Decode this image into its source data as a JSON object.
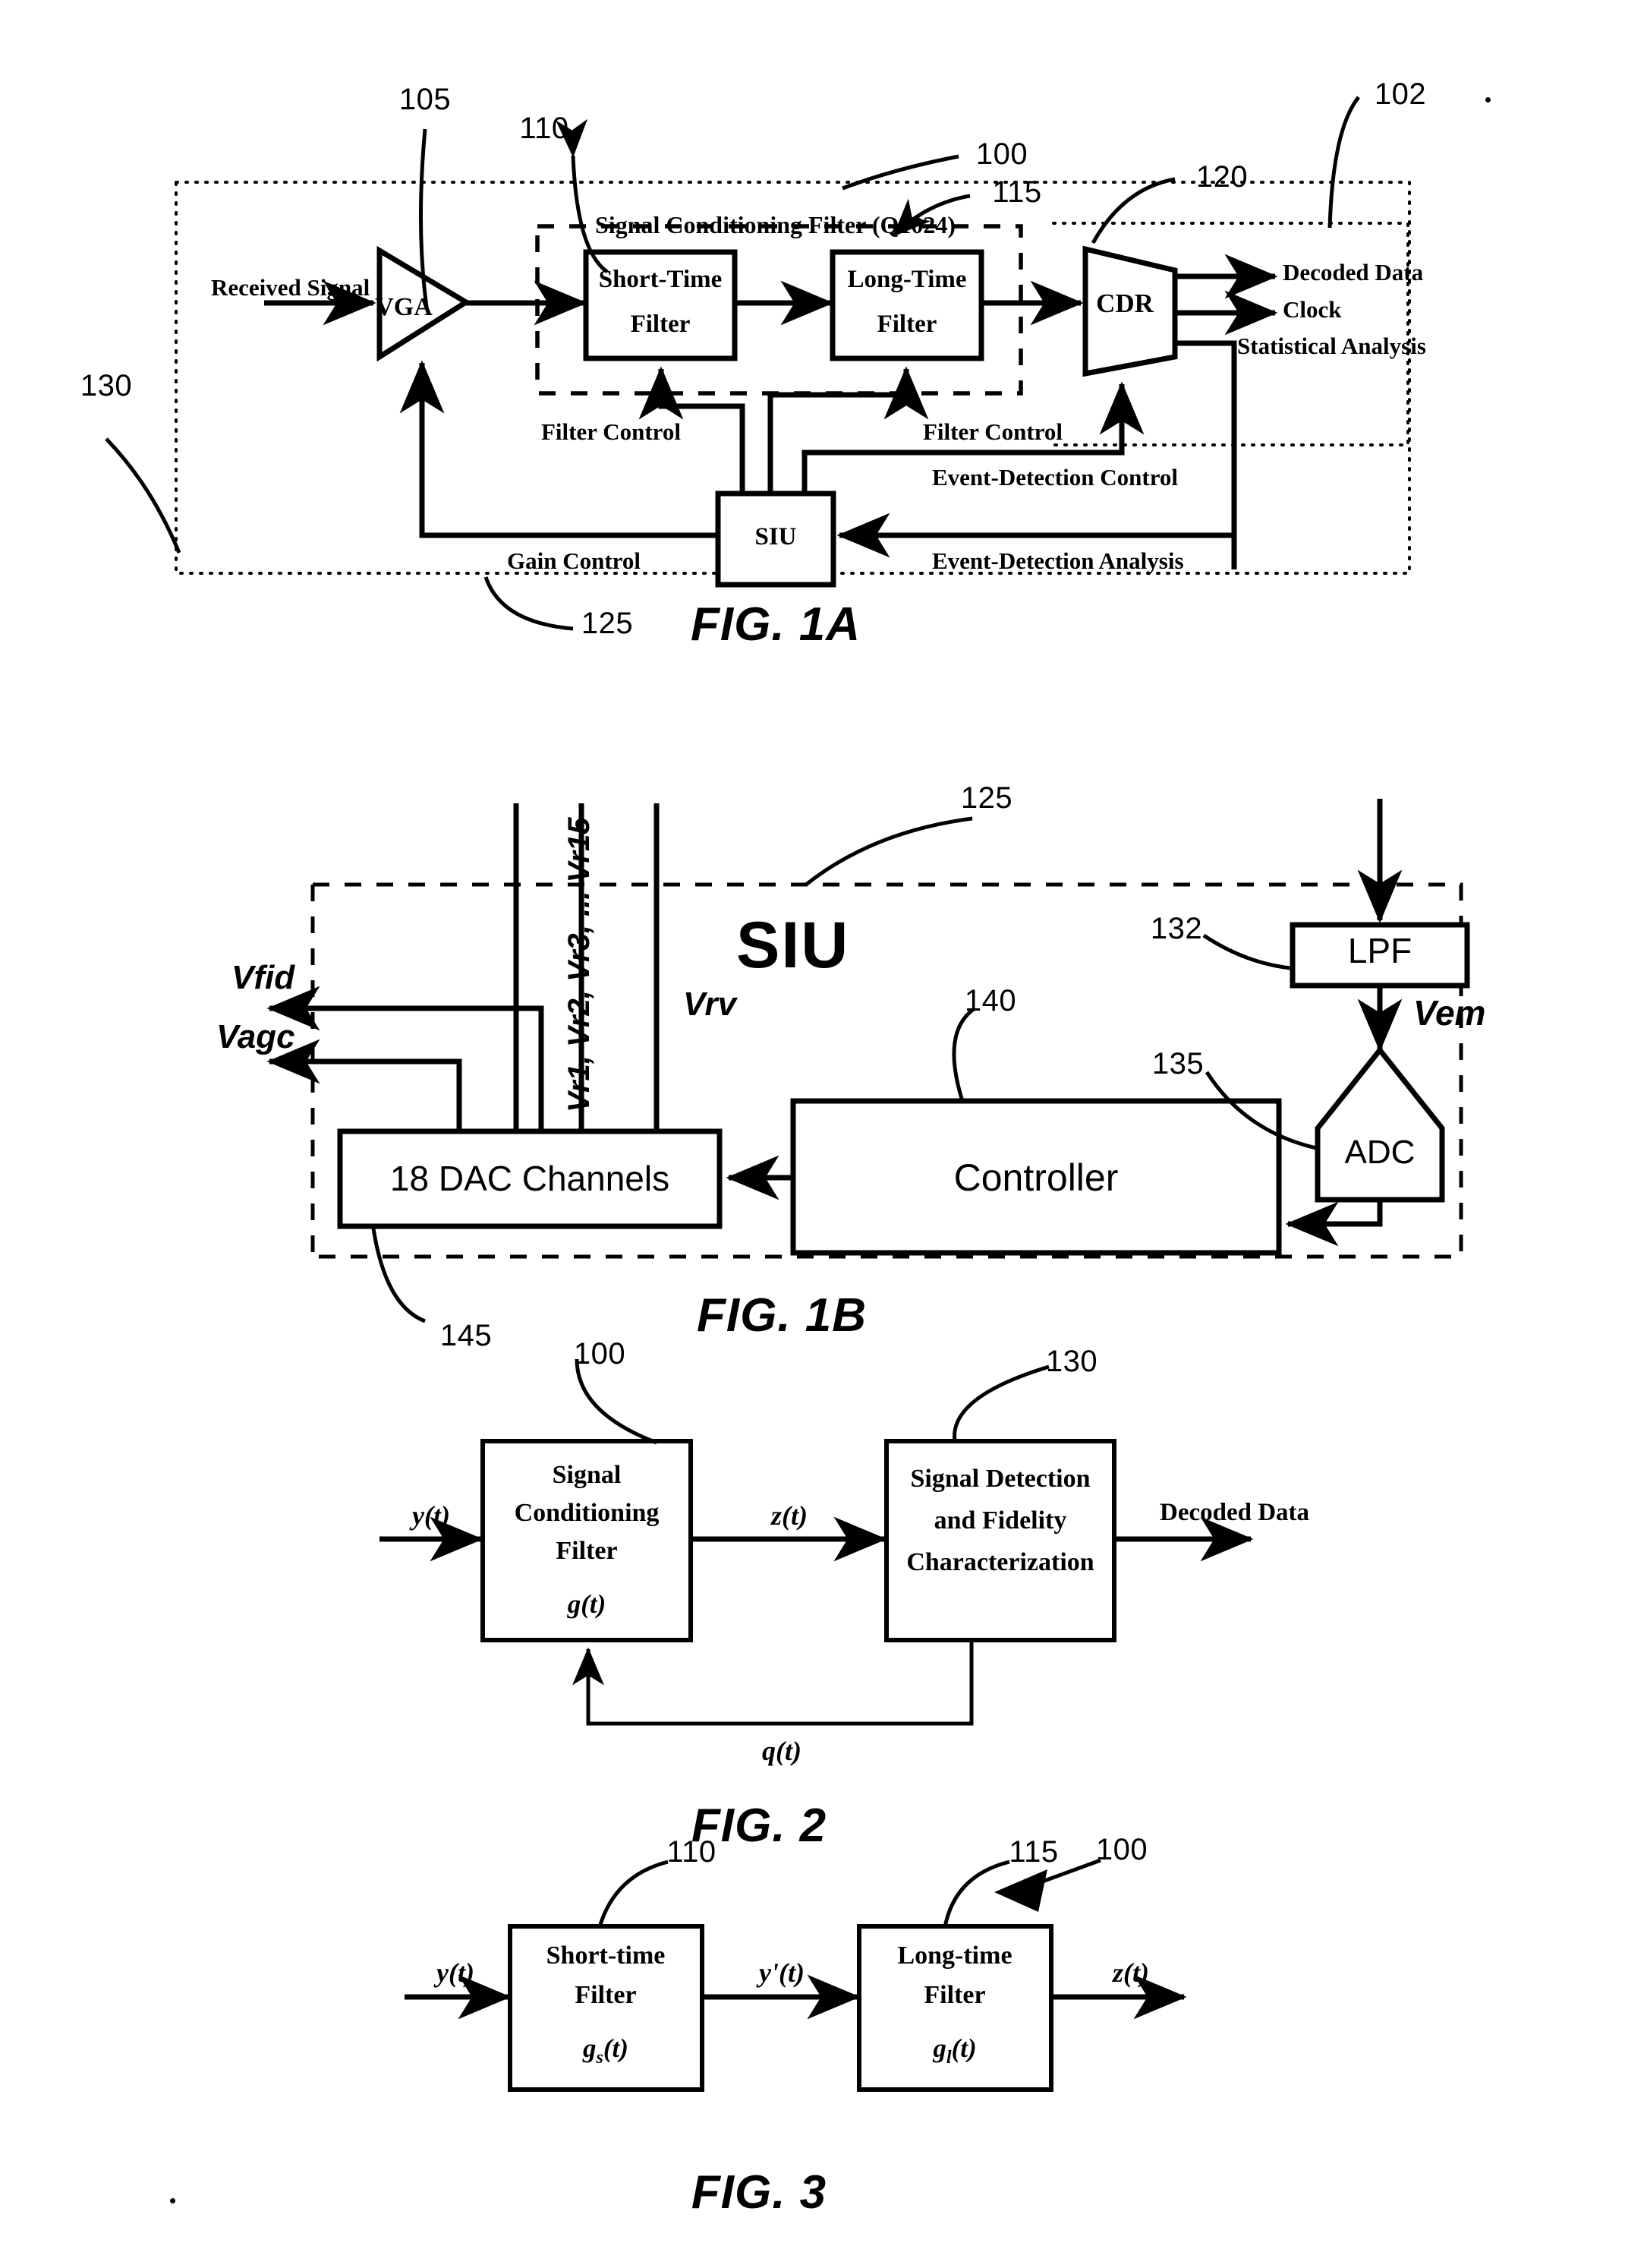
{
  "sheet": {
    "figures": [
      {
        "id": "fig1a",
        "caption": "FIG. 1A"
      },
      {
        "id": "fig1b",
        "caption": "FIG. 1B"
      },
      {
        "id": "fig2",
        "caption": "FIG. 2"
      },
      {
        "id": "fig3",
        "caption": "FIG. 3"
      }
    ]
  },
  "fig1a": {
    "caption": "FIG. 1A",
    "reference_numerals": {
      "n105": "105",
      "n110": "110",
      "n100": "100",
      "n115": "115",
      "n120": "120",
      "n102": "102",
      "n130": "130",
      "n125": "125"
    },
    "group_label": "Signal Conditioning Filter (Q1024)",
    "blocks": {
      "vga": "VGA",
      "short_time_filter_line1": "Short-Time",
      "short_time_filter_line2": "Filter",
      "long_time_filter_line1": "Long-Time",
      "long_time_filter_line2": "Filter",
      "cdr": "CDR",
      "siu": "SIU"
    },
    "signals": {
      "received_signal": "Received Signal",
      "decoded_data": "Decoded Data",
      "clock": "Clock",
      "statistical_analysis": "Statistical Analysis",
      "filter_control_left": "Filter Control",
      "filter_control_right": "Filter Control",
      "event_detection_control": "Event-Detection Control",
      "gain_control": "Gain Control",
      "event_detection_analysis": "Event-Detection Analysis"
    }
  },
  "fig1b": {
    "caption": "FIG. 1B",
    "reference_numerals": {
      "n125": "125",
      "n132": "132",
      "n135": "135",
      "n140": "140",
      "n145": "145"
    },
    "title": "SIU",
    "blocks": {
      "dac_channels": "18 DAC Channels",
      "controller": "Controller",
      "lpf": "LPF",
      "adc": "ADC"
    },
    "signals": {
      "vfid": "Vfid",
      "vagc": "Vagc",
      "vr_bus": "Vr1, Vr2, Vr3, ... Vr15",
      "vrv": "Vrv",
      "vem": "Vem"
    }
  },
  "fig2": {
    "caption": "FIG. 2",
    "reference_numerals": {
      "n100": "100",
      "n130": "130"
    },
    "blocks": {
      "scf_line1": "Signal",
      "scf_line2": "Conditioning",
      "scf_line3": "Filter",
      "scf_transfer": "g(t)",
      "sdfc_line1": "Signal Detection",
      "sdfc_line2": "and Fidelity",
      "sdfc_line3": "Characterization"
    },
    "signals": {
      "input": "y(t)",
      "mid": "z(t)",
      "output": "Decoded Data",
      "feedback": "q(t)"
    }
  },
  "fig3": {
    "caption": "FIG. 3",
    "reference_numerals": {
      "n100": "100",
      "n110": "110",
      "n115": "115"
    },
    "blocks": {
      "short_line1": "Short-time",
      "short_line2": "Filter",
      "short_transfer_main": "g",
      "short_transfer_sub": "s",
      "short_transfer_tail": "(t)",
      "long_line1": "Long-time",
      "long_line2": "Filter",
      "long_transfer_main": "g",
      "long_transfer_sub": "l",
      "long_transfer_tail": "(t)"
    },
    "signals": {
      "input": "y(t)",
      "mid": "y'(t)",
      "output": "z(t)"
    }
  },
  "colors": {
    "ink": "#000000",
    "paper": "#ffffff"
  }
}
